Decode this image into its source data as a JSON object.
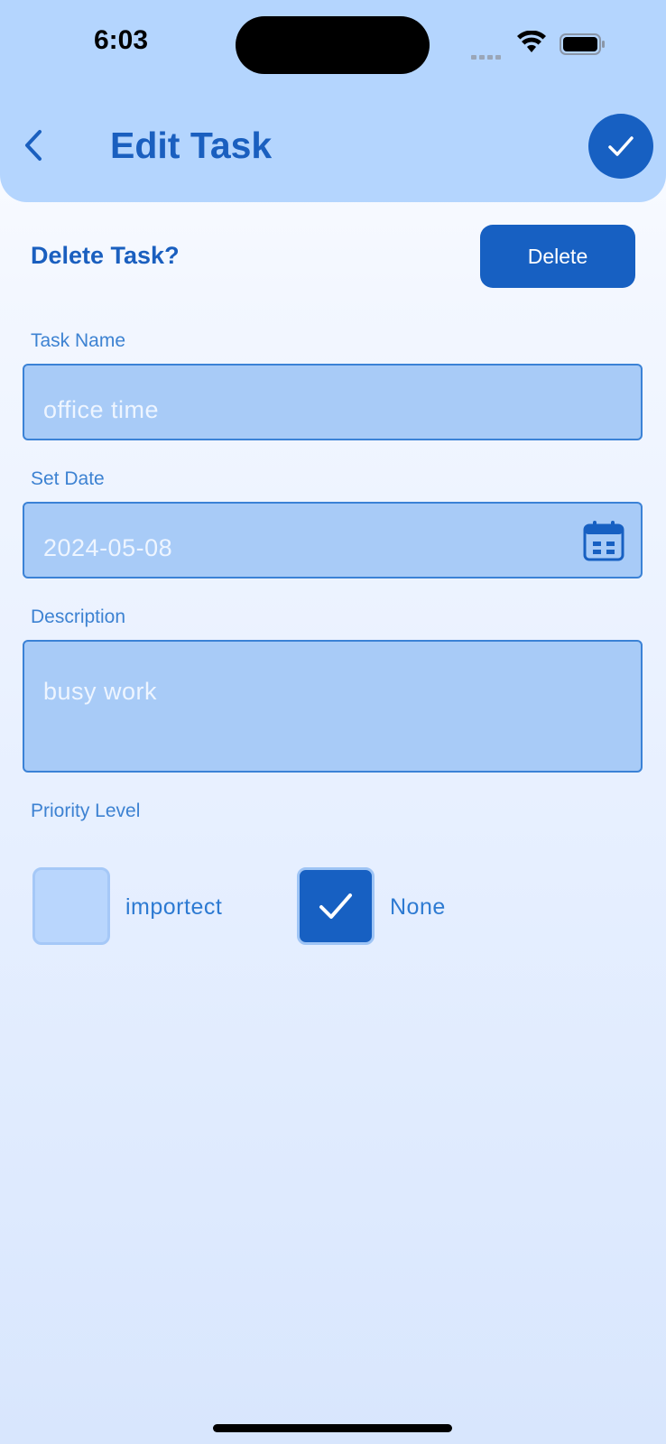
{
  "status_bar": {
    "time": "6:03"
  },
  "header": {
    "title": "Edit Task"
  },
  "delete_section": {
    "prompt": "Delete Task?",
    "button_label": "Delete"
  },
  "form": {
    "task_name": {
      "label": "Task Name",
      "value": "office time"
    },
    "set_date": {
      "label": "Set Date",
      "value": "2024-05-08"
    },
    "description": {
      "label": "Description",
      "value": "busy work"
    },
    "priority": {
      "label": "Priority Level",
      "options": [
        {
          "label": "importect",
          "checked": false
        },
        {
          "label": "None",
          "checked": true
        }
      ]
    }
  },
  "colors": {
    "header_bg": "#b4d5fe",
    "primary": "#1760c2",
    "field_bg": "#a8cbf7",
    "label": "#3d82d2"
  },
  "icons": [
    "back-chevron-icon",
    "checkmark-icon",
    "calendar-icon",
    "wifi-icon",
    "battery-icon"
  ]
}
